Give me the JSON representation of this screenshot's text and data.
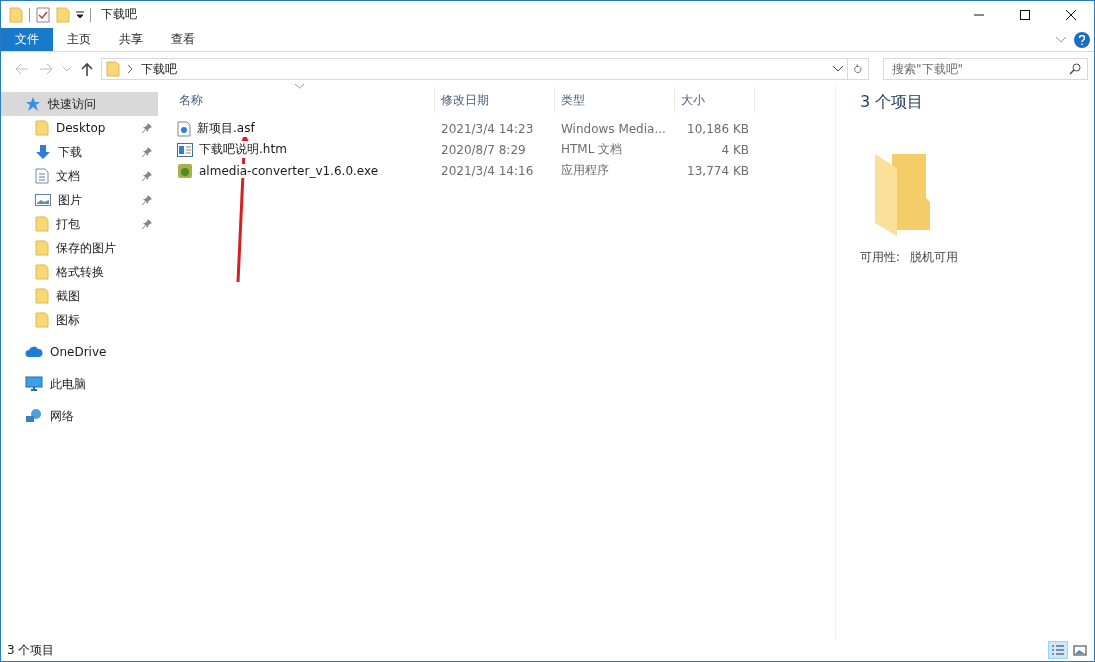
{
  "window": {
    "title": "下载吧"
  },
  "ribbon_tabs": [
    {
      "label": "文件",
      "kind": "menu"
    },
    {
      "label": "主页",
      "kind": "tab"
    },
    {
      "label": "共享",
      "kind": "tab"
    },
    {
      "label": "查看",
      "kind": "tab"
    }
  ],
  "address_bar": {
    "path": "下载吧"
  },
  "search": {
    "placeholder": "搜索\"下载吧\""
  },
  "sidebar": {
    "items": [
      {
        "label": "快速访问",
        "kind": "star",
        "selected": true,
        "pinned": false,
        "children": [
          {
            "label": "Desktop",
            "kind": "folder",
            "selected": false,
            "pinned": true
          },
          {
            "label": "下载",
            "kind": "download",
            "selected": false,
            "pinned": true
          },
          {
            "label": "文档",
            "kind": "document",
            "selected": false,
            "pinned": true
          },
          {
            "label": "图片",
            "kind": "picture",
            "selected": false,
            "pinned": true
          },
          {
            "label": "打包",
            "kind": "folder",
            "selected": false,
            "pinned": true
          },
          {
            "label": "保存的图片",
            "kind": "folder",
            "selected": false,
            "pinned": false
          },
          {
            "label": "格式转换",
            "kind": "folder",
            "selected": false,
            "pinned": false
          },
          {
            "label": "截图",
            "kind": "folder",
            "selected": false,
            "pinned": false
          },
          {
            "label": "图标",
            "kind": "folder",
            "selected": false,
            "pinned": false
          }
        ]
      },
      {
        "label": "OneDrive",
        "kind": "cloud",
        "selected": false,
        "pinned": false
      },
      {
        "label": "此电脑",
        "kind": "pc",
        "selected": false,
        "pinned": false
      },
      {
        "label": "网络",
        "kind": "network",
        "selected": false,
        "pinned": false
      }
    ]
  },
  "table": {
    "columns": [
      "名称",
      "修改日期",
      "类型",
      "大小"
    ],
    "rows": [
      {
        "name": "新项目.asf",
        "kind": "media",
        "date": "2021/3/4 14:23",
        "type": "Windows Media...",
        "size": "10,186 KB"
      },
      {
        "name": "下载吧说明.htm",
        "kind": "html",
        "date": "2020/8/7 8:29",
        "type": "HTML 文档",
        "size": "4 KB"
      },
      {
        "name": "almedia-converter_v1.6.0.exe",
        "kind": "exe",
        "date": "2021/3/4 14:16",
        "type": "应用程序",
        "size": "13,774 KB"
      }
    ]
  },
  "details_pane": {
    "title": "3 个项目",
    "property_label": "可用性:",
    "property_value": "脱机可用"
  },
  "status_bar": {
    "text": "3 个项目",
    "views": [
      {
        "kind": "details",
        "selected": true
      },
      {
        "kind": "thumbnails",
        "selected": false
      }
    ]
  }
}
